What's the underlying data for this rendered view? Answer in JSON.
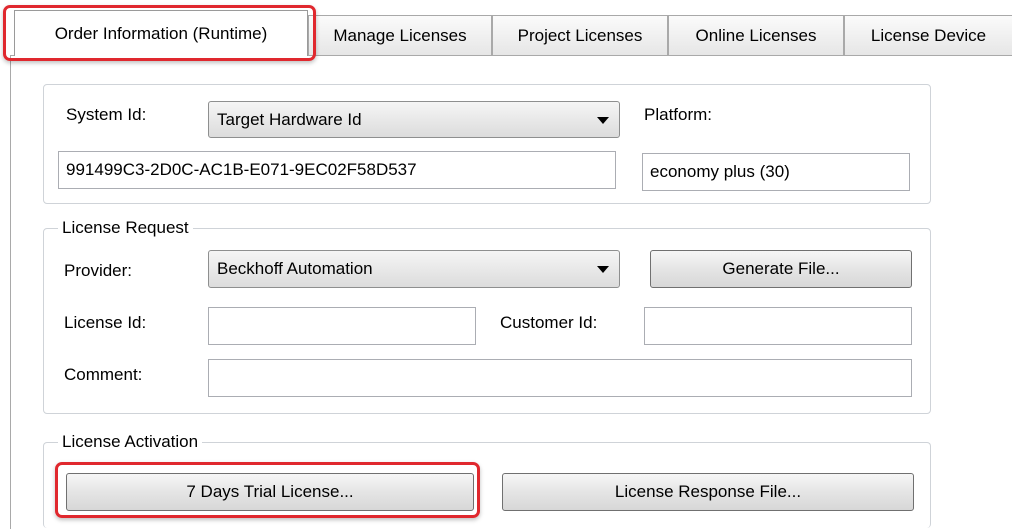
{
  "tabs": [
    {
      "label": "Order Information (Runtime)"
    },
    {
      "label": "Manage Licenses"
    },
    {
      "label": "Project Licenses"
    },
    {
      "label": "Online Licenses"
    },
    {
      "label": "License Device"
    }
  ],
  "system": {
    "system_id_label": "System Id:",
    "system_id_type": "Target Hardware Id",
    "system_id_value": "991499C3-2D0C-AC1B-E071-9EC02F58D537",
    "platform_label": "Platform:",
    "platform_value": "economy plus (30)"
  },
  "license_request": {
    "title": "License Request",
    "provider_label": "Provider:",
    "provider_value": "Beckhoff Automation",
    "generate_button": "Generate File...",
    "license_id_label": "License Id:",
    "license_id_value": "",
    "customer_id_label": "Customer Id:",
    "customer_id_value": "",
    "comment_label": "Comment:",
    "comment_value": ""
  },
  "license_activation": {
    "title": "License Activation",
    "trial_button": "7 Days Trial License...",
    "response_button": "License Response File..."
  },
  "colors": {
    "highlight": "#e0282e"
  }
}
